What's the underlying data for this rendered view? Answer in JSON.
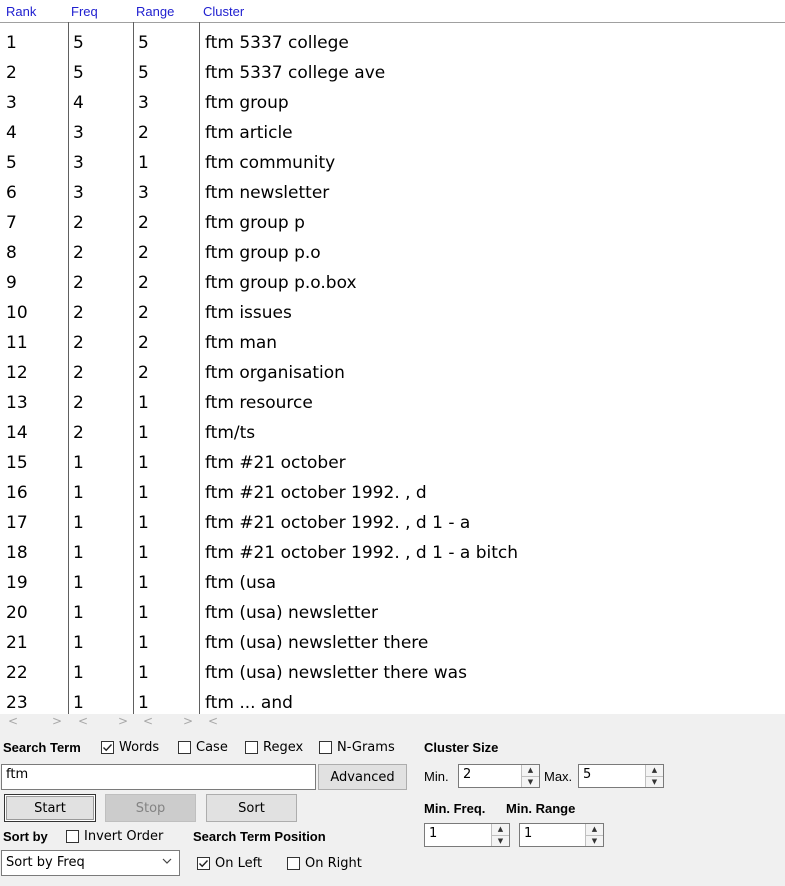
{
  "table": {
    "headers": {
      "rank": "Rank",
      "freq": "Freq",
      "range": "Range",
      "cluster": "Cluster"
    },
    "rows": [
      {
        "rank": "1",
        "freq": "5",
        "range": "5",
        "cluster": "ftm 5337 college"
      },
      {
        "rank": "2",
        "freq": "5",
        "range": "5",
        "cluster": "ftm 5337 college ave"
      },
      {
        "rank": "3",
        "freq": "4",
        "range": "3",
        "cluster": "ftm group"
      },
      {
        "rank": "4",
        "freq": "3",
        "range": "2",
        "cluster": "ftm article"
      },
      {
        "rank": "5",
        "freq": "3",
        "range": "1",
        "cluster": "ftm community"
      },
      {
        "rank": "6",
        "freq": "3",
        "range": "3",
        "cluster": "ftm newsletter"
      },
      {
        "rank": "7",
        "freq": "2",
        "range": "2",
        "cluster": "ftm group p"
      },
      {
        "rank": "8",
        "freq": "2",
        "range": "2",
        "cluster": "ftm group p.o"
      },
      {
        "rank": "9",
        "freq": "2",
        "range": "2",
        "cluster": "ftm group p.o.box"
      },
      {
        "rank": "10",
        "freq": "2",
        "range": "2",
        "cluster": "ftm issues"
      },
      {
        "rank": "11",
        "freq": "2",
        "range": "2",
        "cluster": "ftm man"
      },
      {
        "rank": "12",
        "freq": "2",
        "range": "2",
        "cluster": "ftm organisation"
      },
      {
        "rank": "13",
        "freq": "2",
        "range": "1",
        "cluster": "ftm resource"
      },
      {
        "rank": "14",
        "freq": "2",
        "range": "1",
        "cluster": "ftm/ts"
      },
      {
        "rank": "15",
        "freq": "1",
        "range": "1",
        "cluster": "ftm #21 october"
      },
      {
        "rank": "16",
        "freq": "1",
        "range": "1",
        "cluster": "ftm #21 october 1992. , d"
      },
      {
        "rank": "17",
        "freq": "1",
        "range": "1",
        "cluster": "ftm #21 october 1992. , d 1 - a"
      },
      {
        "rank": "18",
        "freq": "1",
        "range": "1",
        "cluster": "ftm #21 october 1992. , d 1 - a bitch"
      },
      {
        "rank": "19",
        "freq": "1",
        "range": "1",
        "cluster": "ftm (usa"
      },
      {
        "rank": "20",
        "freq": "1",
        "range": "1",
        "cluster": "ftm (usa) newsletter"
      },
      {
        "rank": "21",
        "freq": "1",
        "range": "1",
        "cluster": "ftm (usa) newsletter there"
      },
      {
        "rank": "22",
        "freq": "1",
        "range": "1",
        "cluster": "ftm (usa) newsletter there was"
      },
      {
        "rank": "23",
        "freq": "1",
        "range": "1",
        "cluster": "ftm ... and"
      }
    ]
  },
  "scroll_arrows": {
    "left": "<",
    "right": ">"
  },
  "search": {
    "label": "Search Term",
    "words_label": "Words",
    "words_checked": true,
    "case_label": "Case",
    "case_checked": false,
    "regex_label": "Regex",
    "regex_checked": false,
    "ngrams_label": "N-Grams",
    "ngrams_checked": false,
    "term_value": "ftm",
    "advanced_label": "Advanced"
  },
  "buttons": {
    "start": "Start",
    "stop": "Stop",
    "sort": "Sort"
  },
  "sort": {
    "label": "Sort by",
    "invert_label": "Invert Order",
    "invert_checked": false,
    "selected": "Sort by Freq"
  },
  "position": {
    "label": "Search Term Position",
    "on_left_label": "On Left",
    "on_left_checked": true,
    "on_right_label": "On Right",
    "on_right_checked": false
  },
  "cluster_size": {
    "label": "Cluster Size",
    "min_label": "Min.",
    "min_value": "2",
    "max_label": "Max.",
    "max_value": "5"
  },
  "min_freq": {
    "label": "Min. Freq.",
    "value": "1"
  },
  "min_range": {
    "label": "Min. Range",
    "value": "1"
  },
  "colors": {
    "header_text": "#2020d0",
    "window_bg": "#f0f0f0",
    "disabled_button": "#cccccc"
  }
}
